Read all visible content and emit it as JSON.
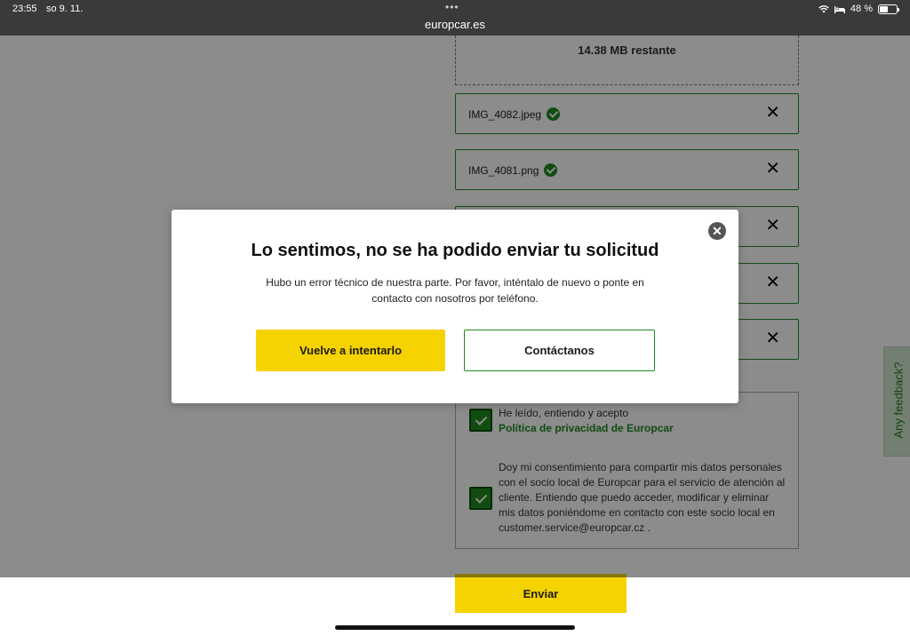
{
  "status_bar": {
    "time": "23:55",
    "date": "so 9. 11.",
    "url": "europcar.es",
    "battery": "48 %",
    "battery_level": 0.48
  },
  "upload": {
    "remaining": "14.38 MB restante",
    "files": [
      {
        "name": "IMG_4082.jpeg"
      },
      {
        "name": "IMG_4081.png"
      },
      {
        "name": ""
      },
      {
        "name": ""
      },
      {
        "name": ""
      }
    ]
  },
  "consent": {
    "privacy_text": "He leído, entiendo y acepto",
    "privacy_link": "Política de privacidad de Europcar",
    "data_share_text": "Doy mi consentimiento para compartir mis datos personales con el socio local de Europcar para el servicio de atención al cliente. Entiendo que puedo acceder, modificar y eliminar mis datos poniéndome en contacto con este socio local en customer.service@europcar.cz ."
  },
  "feedback": {
    "label": "Any feedback?"
  },
  "submit_label": "Enviar",
  "modal": {
    "title": "Lo sentimos, no se ha podido enviar tu solicitud",
    "body_line1": "Hubo un error técnico de nuestra parte. Por favor, inténtalo de nuevo o ponte en",
    "body_line2": "contacto con nosotros por teléfono.",
    "retry_label": "Vuelve a intentarlo",
    "contact_label": "Contáctanos"
  },
  "colors": {
    "brand_green": "#1f8a1f",
    "brand_yellow": "#f5d300"
  }
}
